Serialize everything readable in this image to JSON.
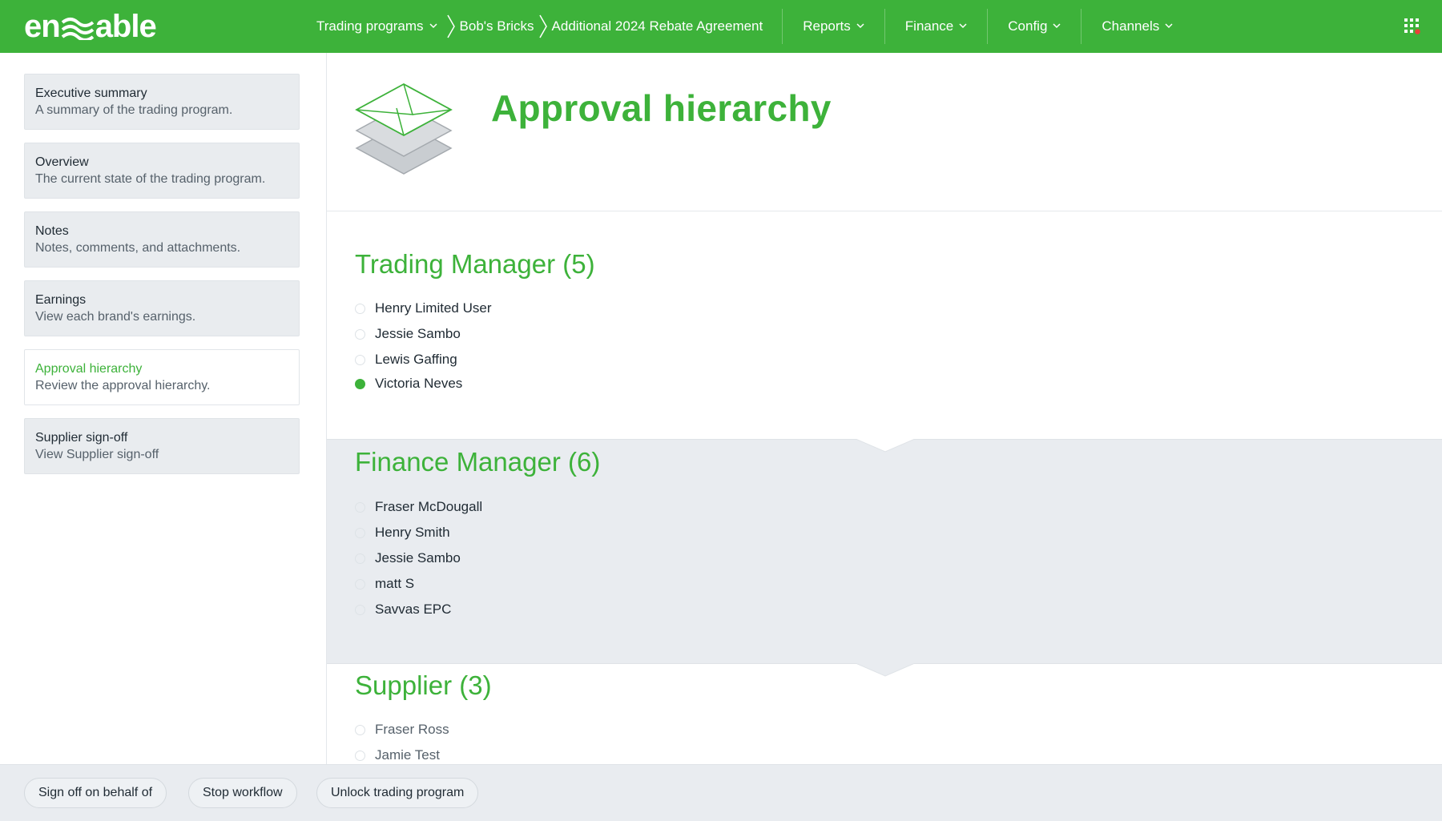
{
  "app": {
    "logo_text_left": "en",
    "logo_text_right": "able",
    "accent_color": "#3db23a"
  },
  "topnav": {
    "trading_programs": "Trading programs",
    "breadcrumb_1": "Bob's Bricks",
    "breadcrumb_2": "Additional 2024 Rebate Agreement",
    "reports": "Reports",
    "finance": "Finance",
    "config": "Config",
    "channels": "Channels",
    "apps_icon": "grid-icon"
  },
  "sidebar": {
    "items": [
      {
        "title": "Executive summary",
        "subtitle": "A summary of the trading program."
      },
      {
        "title": "Overview",
        "subtitle": "The current state of the trading program."
      },
      {
        "title": "Notes",
        "subtitle": "Notes, comments, and attachments."
      },
      {
        "title": "Earnings",
        "subtitle": "View each brand's earnings."
      },
      {
        "title": "Approval hierarchy",
        "subtitle": "Review the approval hierarchy.",
        "active": true
      },
      {
        "title": "Supplier sign-off",
        "subtitle": "View Supplier sign-off"
      }
    ]
  },
  "main": {
    "title": "Approval hierarchy",
    "header_icon": "envelope-stack-icon",
    "sections": [
      {
        "heading": "Trading Manager (5)",
        "approvers": [
          {
            "name": "Henry Limited User",
            "approved": false
          },
          {
            "name": "Jessie Sambo",
            "approved": false
          },
          {
            "name": "Lewis Gaffing",
            "approved": false
          },
          {
            "name": "Victoria Neves",
            "approved": true
          }
        ]
      },
      {
        "heading": "Finance Manager (6)",
        "approvers": [
          {
            "name": "Fraser McDougall",
            "approved": false
          },
          {
            "name": "Henry Smith",
            "approved": false
          },
          {
            "name": "Jessie Sambo",
            "approved": false
          },
          {
            "name": "matt S",
            "approved": false
          },
          {
            "name": "Savvas EPC",
            "approved": false
          }
        ]
      },
      {
        "heading": "Supplier (3)",
        "approvers": [
          {
            "name": "Fraser Ross",
            "approved": false
          },
          {
            "name": "Jamie Test",
            "approved": false
          }
        ]
      }
    ]
  },
  "footer": {
    "sign_off": "Sign off on behalf of",
    "stop_workflow": "Stop workflow",
    "unlock": "Unlock trading program"
  }
}
